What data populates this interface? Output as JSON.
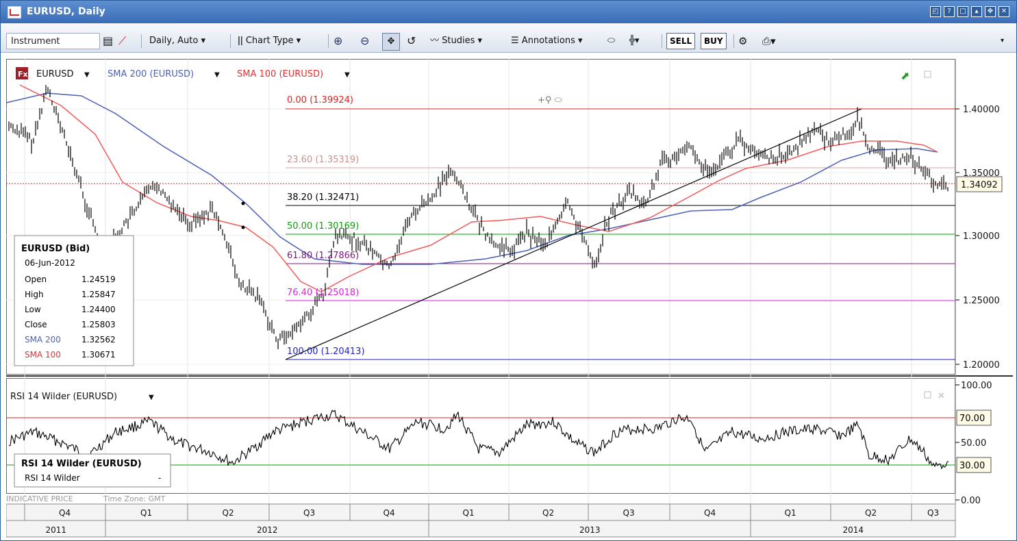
{
  "window": {
    "title": "EURUSD, Daily",
    "controls": [
      "restore-icon",
      "help-icon",
      "maximize-icon",
      "float-icon",
      "expand-icon",
      "close-icon"
    ]
  },
  "toolbar": {
    "instrument_placeholder": "Instrument",
    "interval_label": "Daily,  Auto",
    "chart_type_label": "Chart Type",
    "studies_label": "Studies",
    "annotations_label": "Annotations",
    "sell_label": "SELL",
    "buy_label": "BUY"
  },
  "main_chart": {
    "legend": {
      "fx_badge": "Fx",
      "instrument": "EURUSD",
      "sma200": "SMA 200 (EURUSD)",
      "sma100": "SMA 100 (EURUSD)"
    },
    "fib_labels": [
      {
        "text": "0.00 (1.39924)",
        "color": "#e02020"
      },
      {
        "text": "23.60 (1.35319)",
        "color": "#c89090"
      },
      {
        "text": "38.20 (1.32471)",
        "color": "#000000"
      },
      {
        "text": "50.00 (1.30169)",
        "color": "#119911"
      },
      {
        "text": "61.80 (1.27866)",
        "color": "#7a1a7a"
      },
      {
        "text": "76.40 (1.25018)",
        "color": "#e020e0"
      },
      {
        "text": "100.00 (1.20413)",
        "color": "#2020cc"
      }
    ],
    "y_ticks": [
      "1.40000",
      "1.35000",
      "1.30000",
      "1.25000",
      "1.20000"
    ],
    "current_price": "1.34092",
    "tooltip": {
      "header": "EURUSD (Bid)",
      "date": "06-Jun-2012",
      "rows": [
        {
          "label": "Open",
          "value": "1.24519"
        },
        {
          "label": "High",
          "value": "1.25847"
        },
        {
          "label": "Low",
          "value": "1.24400"
        },
        {
          "label": "Close",
          "value": "1.25803"
        },
        {
          "label": "SMA 200",
          "value": "1.32562"
        },
        {
          "label": "SMA 100",
          "value": "1.30671"
        }
      ]
    }
  },
  "rsi_panel": {
    "title": "RSI 14 Wilder (EURUSD)",
    "y_ticks": [
      "100.00",
      "50.00",
      "0.00"
    ],
    "level_labels": [
      "70.00",
      "30.00"
    ],
    "tooltip": {
      "header": "RSI 14 Wilder (EURUSD)",
      "row_label": "RSI 14 Wilder",
      "row_value": "-"
    }
  },
  "footer": {
    "indicative": "INDICATIVE PRICE",
    "timezone": "Time Zone: GMT",
    "quarters": [
      "Q4",
      "Q1",
      "Q2",
      "Q3",
      "Q4",
      "Q1",
      "Q2",
      "Q3",
      "Q4",
      "Q1",
      "Q2",
      "Q3"
    ],
    "years": [
      "2011",
      "2012",
      "2013",
      "2014"
    ]
  },
  "colors": {
    "title_bar": "#3a6db8",
    "sma200": "#4a5fb5",
    "sma100": "#f25a5a",
    "price": "#000000",
    "rsi_upper": "#e02020",
    "rsi_lower": "#119911"
  }
}
